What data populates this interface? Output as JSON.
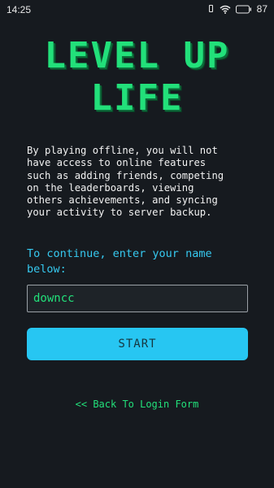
{
  "status_bar": {
    "time": "14:25",
    "battery_level": "87",
    "icons": [
      "vibrate-icon",
      "wifi-icon",
      "battery-icon"
    ]
  },
  "title": {
    "line1": "LEVEL UP",
    "line2": "LIFE"
  },
  "info_text": "By playing offline, you will not\nhave access to online features\nsuch as adding friends, competing\non the leaderboards, viewing\nothers achievements, and syncing\nyour activity to server backup.",
  "prompt_text": "To continue, enter your name\nbelow:",
  "name_input": {
    "value": "downcc",
    "placeholder": ""
  },
  "start_button": {
    "label": "START"
  },
  "back_link": {
    "label": "<< Back To Login Form"
  },
  "colors": {
    "background": "#161a1f",
    "title_green": "#22e07a",
    "accent_cyan": "#27c6f2",
    "prompt_cyan": "#36c9f0",
    "text_white": "#f2f2f2"
  }
}
